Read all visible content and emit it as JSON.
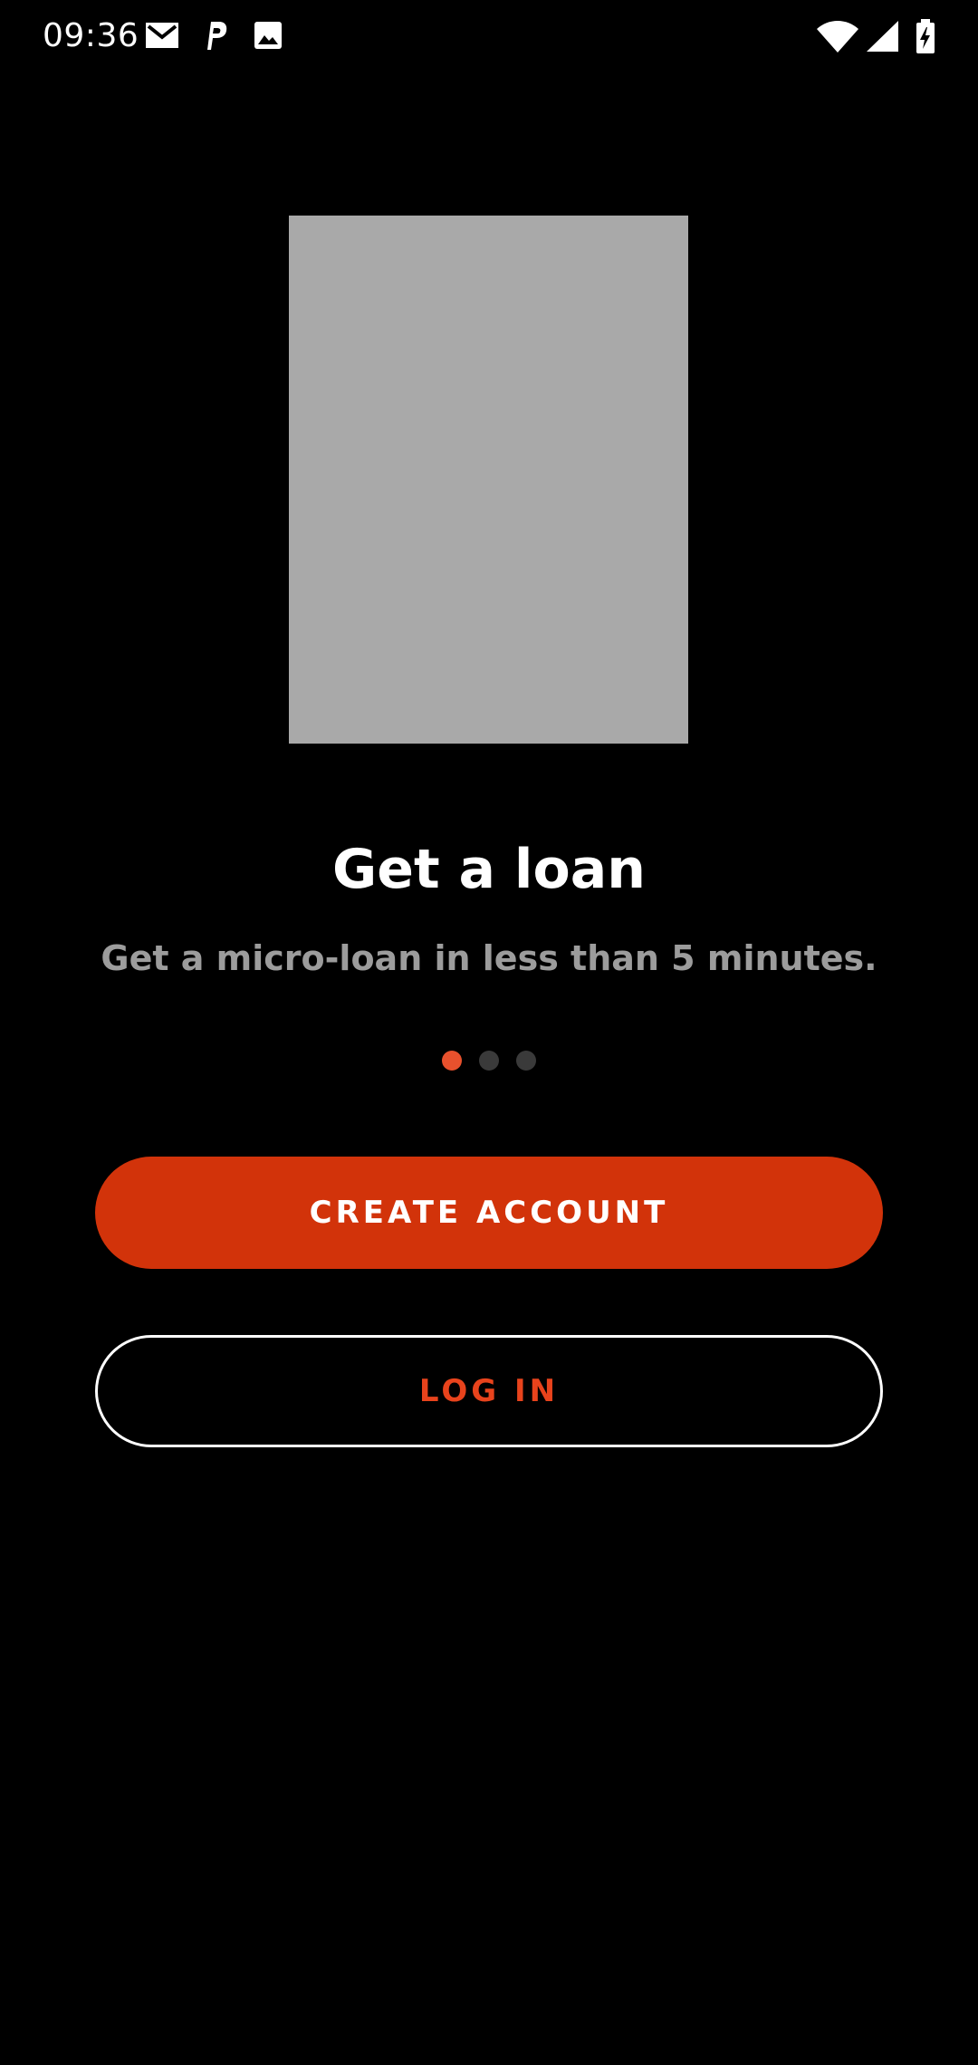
{
  "status_bar": {
    "time": "09:36",
    "icons": [
      "gmail-icon",
      "parking-icon",
      "image-icon",
      "wifi-icon",
      "cellular-signal-icon",
      "battery-charging-icon"
    ]
  },
  "onboarding": {
    "image_placeholder": "onboarding-illustration",
    "title": "Get a loan",
    "subtitle": "Get a micro-loan in less than 5 minutes.",
    "page_count": 3,
    "active_page": 1
  },
  "actions": {
    "create_account_label": "CREATE ACCOUNT",
    "login_label": "LOG IN"
  },
  "colors": {
    "background": "#000000",
    "accent": "#d2330a",
    "accent_text": "#e8431c",
    "dot_active": "#e8512d",
    "dot_inactive": "#3a3a3a",
    "subtitle": "#9c9c9c",
    "placeholder": "#a9a9a9"
  }
}
